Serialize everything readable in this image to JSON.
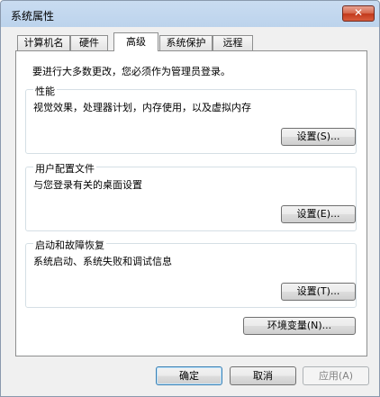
{
  "window": {
    "title": "系统属性",
    "close_glyph": "✕"
  },
  "tabs": [
    {
      "label": "计算机名"
    },
    {
      "label": "硬件"
    },
    {
      "label": "高级"
    },
    {
      "label": "系统保护"
    },
    {
      "label": "远程"
    }
  ],
  "notice": "要进行大多数更改，您必须作为管理员登录。",
  "groups": {
    "performance": {
      "title": "性能",
      "desc": "视觉效果，处理器计划，内存使用，以及虚拟内存",
      "button": "设置(S)..."
    },
    "profile": {
      "title": "用户配置文件",
      "desc": "与您登录有关的桌面设置",
      "button": "设置(E)..."
    },
    "startup": {
      "title": "启动和故障恢复",
      "desc": "系统启动、系统失败和调试信息",
      "button": "设置(T)..."
    }
  },
  "env_button": "环境变量(N)...",
  "footer": {
    "ok": "确定",
    "cancel": "取消",
    "apply": "应用(A)"
  }
}
